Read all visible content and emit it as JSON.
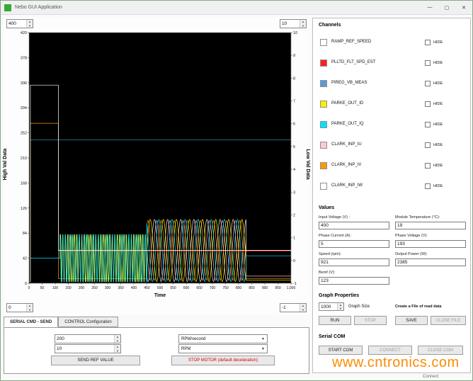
{
  "window": {
    "title": "Nebo GUI Application",
    "controls": {
      "minimize": "—",
      "maximize": "▢",
      "close": "✕"
    }
  },
  "chart_panel": {
    "spinner_top_left": "400",
    "spinner_top_right": "10",
    "spinner_bottom_left": "0",
    "spinner_bottom_right": "-1"
  },
  "chart_data": {
    "type": "line",
    "xlabel": "Time",
    "ylabel_left": "High Val Data",
    "ylabel_right": "Low Val Data",
    "xlim": [
      0,
      1000
    ],
    "ylim_left": [
      0,
      420
    ],
    "ylim_right": [
      -1,
      10
    ],
    "background": "#000000",
    "grid": false,
    "x_ticks": [
      0,
      50,
      100,
      150,
      200,
      250,
      300,
      350,
      400,
      450,
      500,
      550,
      600,
      650,
      700,
      750,
      800,
      850,
      900,
      950,
      1000
    ],
    "x_tick_labels": [
      "0",
      "50",
      "100",
      "150",
      "200",
      "250",
      "300",
      "350",
      "400",
      "450",
      "500",
      "550",
      "600",
      "650",
      "700",
      "750",
      "800",
      "850",
      "900",
      "950",
      "1,000"
    ],
    "y_ticks_left": [
      0,
      42,
      84,
      126,
      168,
      210,
      252,
      294,
      336,
      378,
      420
    ],
    "y_ticks_right": [
      -1,
      0,
      1,
      2,
      3,
      4,
      5,
      6,
      7,
      8,
      9,
      10
    ],
    "series": [
      {
        "name": "PLLTD_FLT_SPD_EST",
        "color": "#ff2020",
        "segments": [
          {
            "type": "points",
            "points": [
              [
                113,
                54
              ],
              [
                1000,
                54
              ]
            ]
          }
        ]
      },
      {
        "name": "CLARK_INP_IW",
        "color": "#e8e8e8",
        "segments": [
          {
            "type": "sine",
            "x0": 450,
            "x1": 828,
            "center": 55,
            "amp": 52,
            "period": 50,
            "phase": 4.2
          },
          {
            "type": "points",
            "points": [
              [
                828,
                55
              ],
              [
                1000,
                55
              ]
            ]
          }
        ]
      },
      {
        "name": "CLARK_INP_IU",
        "color": "#ffb3c0",
        "segments": [
          {
            "type": "sine",
            "x0": 450,
            "x1": 828,
            "center": 55,
            "amp": 50,
            "period": 50,
            "phase": 3.1
          },
          {
            "type": "points",
            "points": [
              [
                828,
                12
              ],
              [
                1000,
                12
              ]
            ]
          }
        ]
      },
      {
        "name": "CLARK_INP_IV",
        "color": "#ff9900",
        "segments": [
          {
            "type": "points",
            "points": [
              [
                5,
                2
              ],
              [
                5,
                268
              ],
              [
                112,
                268
              ],
              [
                112,
                8
              ],
              [
                450,
                8
              ]
            ]
          },
          {
            "type": "sine",
            "x0": 450,
            "x1": 828,
            "center": 55,
            "amp": 50,
            "period": 50,
            "phase": 1.05
          },
          {
            "type": "points",
            "points": [
              [
                828,
                8
              ],
              [
                1000,
                8
              ]
            ]
          }
        ]
      },
      {
        "name": "PARKE_OUT_ID",
        "color": "#ffee00",
        "segments": [
          {
            "type": "sine",
            "x0": 118,
            "x1": 450,
            "center": 42,
            "amp": 40,
            "period": 9,
            "phase": 0
          },
          {
            "type": "sine",
            "x0": 450,
            "x1": 828,
            "center": 55,
            "amp": 52,
            "period": 50,
            "phase": 0
          },
          {
            "type": "points",
            "points": [
              [
                828,
                5
              ],
              [
                1000,
                5
              ]
            ]
          }
        ]
      },
      {
        "name": "PARKE_OUT_IQ",
        "color": "#00e0ff",
        "segments": [
          {
            "type": "points",
            "points": [
              [
                5,
                42
              ],
              [
                118,
                42
              ]
            ]
          },
          {
            "type": "sine",
            "x0": 118,
            "x1": 450,
            "center": 42,
            "amp": 40,
            "period": 10.5,
            "phase": 1.6
          },
          {
            "type": "sine",
            "x0": 450,
            "x1": 828,
            "center": 55,
            "amp": 52,
            "period": 50,
            "phase": 2.1
          },
          {
            "type": "points",
            "points": [
              [
                828,
                46
              ],
              [
                1000,
                46
              ]
            ]
          }
        ]
      },
      {
        "name": "PIREG_VB_MEAS",
        "color": "#35a0d8",
        "segments": [
          {
            "type": "points",
            "points": [
              [
                3,
                240
              ],
              [
                1000,
                240
              ]
            ]
          }
        ]
      },
      {
        "name": "RAMP_REF_SPEED",
        "color": "#ffffff",
        "segments": [
          {
            "type": "points",
            "points": [
              [
                5,
                2
              ],
              [
                5,
                332
              ],
              [
                112,
                332
              ],
              [
                112,
                55
              ],
              [
                1000,
                55
              ]
            ]
          }
        ]
      }
    ]
  },
  "tabs": [
    {
      "label": "SERIAL CMD - SEND",
      "active": true
    },
    {
      "label": "CONTROL Configuration",
      "active": false
    }
  ],
  "serial_cmd": {
    "ref_value": "200",
    "accel_value": "10",
    "send_button": "SEND REF VALUE",
    "unit_dropdown_1": "RPM/second",
    "unit_dropdown_2": "RPM",
    "stop_button": "STOP MOTOR (default deceleration)",
    "stop_color": "#d40000"
  },
  "channels": {
    "header": "Channels",
    "hide_label": "HIDE",
    "items": [
      {
        "name": "RAMP_REF_SPEED",
        "color": "#ffffff"
      },
      {
        "name": "PLLTD_FLT_SPD_EST",
        "color": "#ff2020"
      },
      {
        "name": "PIREG_VB_MEAS",
        "color": "#5b9bd5"
      },
      {
        "name": "PARKE_OUT_ID",
        "color": "#ffee00"
      },
      {
        "name": "PARKE_OUT_IQ",
        "color": "#00e0ff"
      },
      {
        "name": "CLARK_INP_IU",
        "color": "#ffc9d2"
      },
      {
        "name": "CLARK_INP_IV",
        "color": "#ff9900"
      },
      {
        "name": "CLARK_INP_IW",
        "color": "#ffffff"
      }
    ]
  },
  "values": {
    "header": "Values",
    "fields": [
      {
        "label": "Input Voltage (V) :",
        "value": "400"
      },
      {
        "label": "Module Temperature (°C):",
        "value": "19"
      },
      {
        "label": "Phase Current (A):",
        "value": "5"
      },
      {
        "label": "Phase Voltage (V):",
        "value": "193"
      },
      {
        "label": "Speed (rpm):",
        "value": "921"
      },
      {
        "label": "Output Power (W):",
        "value": "2385"
      },
      {
        "label": "Bemf (V):",
        "value": "123"
      }
    ]
  },
  "graph_properties": {
    "header": "Graph Properties",
    "graph_size_value": "1000",
    "graph_size_label": "Graph Size",
    "file_label": "Create a File of read data",
    "run": "RUN",
    "stop": "STOP",
    "save": "SAVE",
    "close_file": "CLOSE FILE"
  },
  "serial_com": {
    "header": "Serial COM",
    "buttons": [
      "START COM",
      "CONNECT",
      "CLOSE COM"
    ]
  },
  "watermark": {
    "text": "www.cntronics.com",
    "color": "#ff8a00"
  },
  "status_text": "Connect"
}
